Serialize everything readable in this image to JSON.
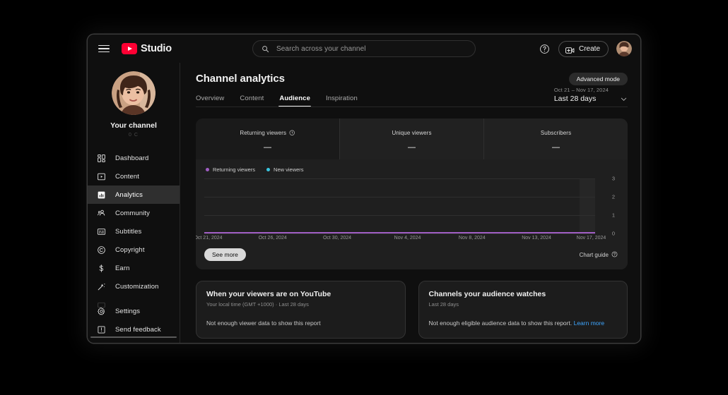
{
  "topbar": {
    "menu_icon": "hamburger-icon",
    "brand": "Studio",
    "search": {
      "placeholder": "Search across your channel",
      "icon": "search-icon",
      "value": ""
    },
    "help_icon": "help-circle-icon",
    "create_label": "Create",
    "create_icon": "video-plus-icon",
    "avatar": "account-avatar"
  },
  "sidebar": {
    "channel_name": "Your channel",
    "channel_handle": "0 C",
    "items": [
      {
        "label": "Dashboard",
        "icon": "dashboard-icon",
        "active": false
      },
      {
        "label": "Content",
        "icon": "content-icon",
        "active": false
      },
      {
        "label": "Analytics",
        "icon": "analytics-icon",
        "active": true
      },
      {
        "label": "Community",
        "icon": "community-icon",
        "active": false
      },
      {
        "label": "Subtitles",
        "icon": "subtitles-icon",
        "active": false
      },
      {
        "label": "Copyright",
        "icon": "copyright-icon",
        "active": false
      },
      {
        "label": "Earn",
        "icon": "earn-dollar-icon",
        "active": false
      },
      {
        "label": "Customization",
        "icon": "customization-wand-icon",
        "active": false
      }
    ],
    "bottom_items": [
      {
        "label": "Settings",
        "icon": "gear-icon"
      },
      {
        "label": "Send feedback",
        "icon": "feedback-icon"
      }
    ]
  },
  "main": {
    "page_title": "Channel analytics",
    "advanced_mode": "Advanced mode",
    "tabs": [
      {
        "label": "Overview",
        "active": false
      },
      {
        "label": "Content",
        "active": false
      },
      {
        "label": "Audience",
        "active": true
      },
      {
        "label": "Inspiration",
        "active": false
      }
    ],
    "date_range": {
      "range": "Oct 21 – Nov 17, 2024",
      "preset": "Last 28 days",
      "chevron": "chevron-down-icon"
    },
    "metrics": [
      {
        "label": "Returning viewers",
        "value": "—",
        "selected": true,
        "has_info_icon": true
      },
      {
        "label": "Unique viewers",
        "value": "—",
        "selected": false,
        "has_info_icon": false
      },
      {
        "label": "Subscribers",
        "value": "—",
        "selected": false,
        "has_info_icon": false
      }
    ],
    "see_more": "See more",
    "chart_guide": "Chart guide",
    "chart_guide_icon": "help-circle-icon",
    "bottom_cards": [
      {
        "title": "When your viewers are on YouTube",
        "subtitle": "Your local time (GMT +1000) · Last 28 days",
        "message": "Not enough viewer data to show this report",
        "link": ""
      },
      {
        "title": "Channels your audience watches",
        "subtitle": "Last 28 days",
        "message": "Not enough eligible audience data to show this report.",
        "link": "Learn more"
      }
    ]
  },
  "chart_data": {
    "type": "line",
    "title": "Returning viewers and New viewers",
    "xlabel": "",
    "ylabel": "",
    "ylim": [
      0,
      3
    ],
    "yticks": [
      3,
      2,
      1,
      0
    ],
    "grid": true,
    "legend_position": "top-left",
    "x_tick_labels": [
      "Oct 21, 2024",
      "Oct 26, 2024",
      "Oct 30, 2024",
      "Nov 4, 2024",
      "Nov 8, 2024",
      "Nov 13, 2024",
      "Nov 17, 2024"
    ],
    "x_tick_positions_pct": [
      1,
      17.5,
      34,
      52,
      68.5,
      85,
      99
    ],
    "series": [
      {
        "name": "Returning viewers",
        "color": "#a05ec4",
        "values": [
          0,
          0,
          0,
          0,
          0,
          0,
          0,
          0,
          0,
          0,
          0,
          0,
          0,
          0,
          0,
          0,
          0,
          0,
          0,
          0,
          0,
          0,
          0,
          0,
          0,
          0,
          0,
          0
        ]
      },
      {
        "name": "New viewers",
        "color": "#3ac6e0",
        "values": [
          0,
          0,
          0,
          0,
          0,
          0,
          0,
          0,
          0,
          0,
          0,
          0,
          0,
          0,
          0,
          0,
          0,
          0,
          0,
          0,
          0,
          0,
          0,
          0,
          0,
          0,
          0,
          0
        ]
      }
    ],
    "annotations": [
      "shaded band at right edge indicates incomplete data"
    ]
  },
  "colors": {
    "page_bg": "#0f0f0f",
    "card_bg": "#1f1f1f",
    "accent_red": "#ff0033",
    "link_blue": "#3ea6ff",
    "returning_purple": "#a05ec4",
    "new_cyan": "#3ac6e0"
  }
}
